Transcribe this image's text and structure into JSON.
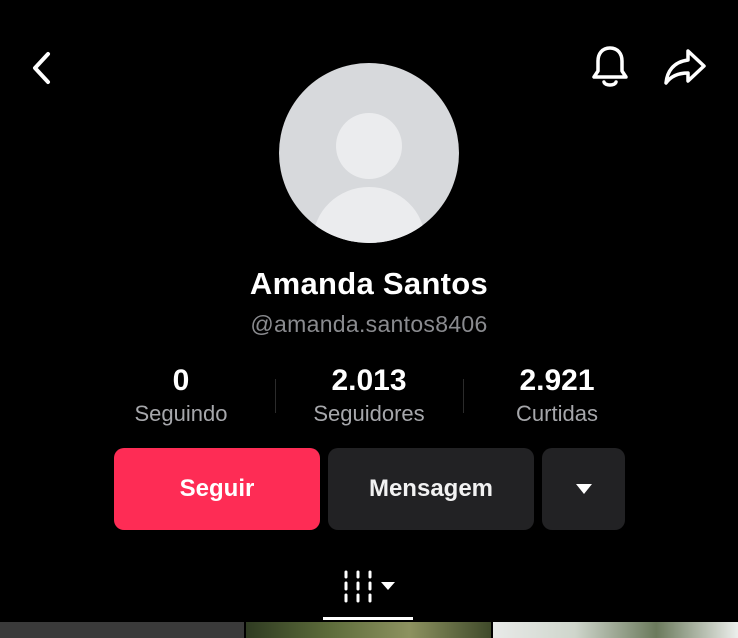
{
  "profile": {
    "name": "Amanda Santos",
    "handle": "@amanda.santos8406"
  },
  "stats": [
    {
      "value": "0",
      "label": "Seguindo"
    },
    {
      "value": "2.013",
      "label": "Seguidores"
    },
    {
      "value": "2.921",
      "label": "Curtidas"
    }
  ],
  "actions": {
    "follow_label": "Seguir",
    "message_label": "Mensagem"
  },
  "icons": {
    "back": "back-chevron-icon",
    "bell": "bell-icon",
    "share": "share-arrow-icon",
    "more": "caret-down-icon",
    "grid": "grid-icon"
  },
  "colors": {
    "background": "#000000",
    "accent": "#fe2c55",
    "secondary_button": "#222224",
    "muted_text": "#8a8b8f"
  }
}
